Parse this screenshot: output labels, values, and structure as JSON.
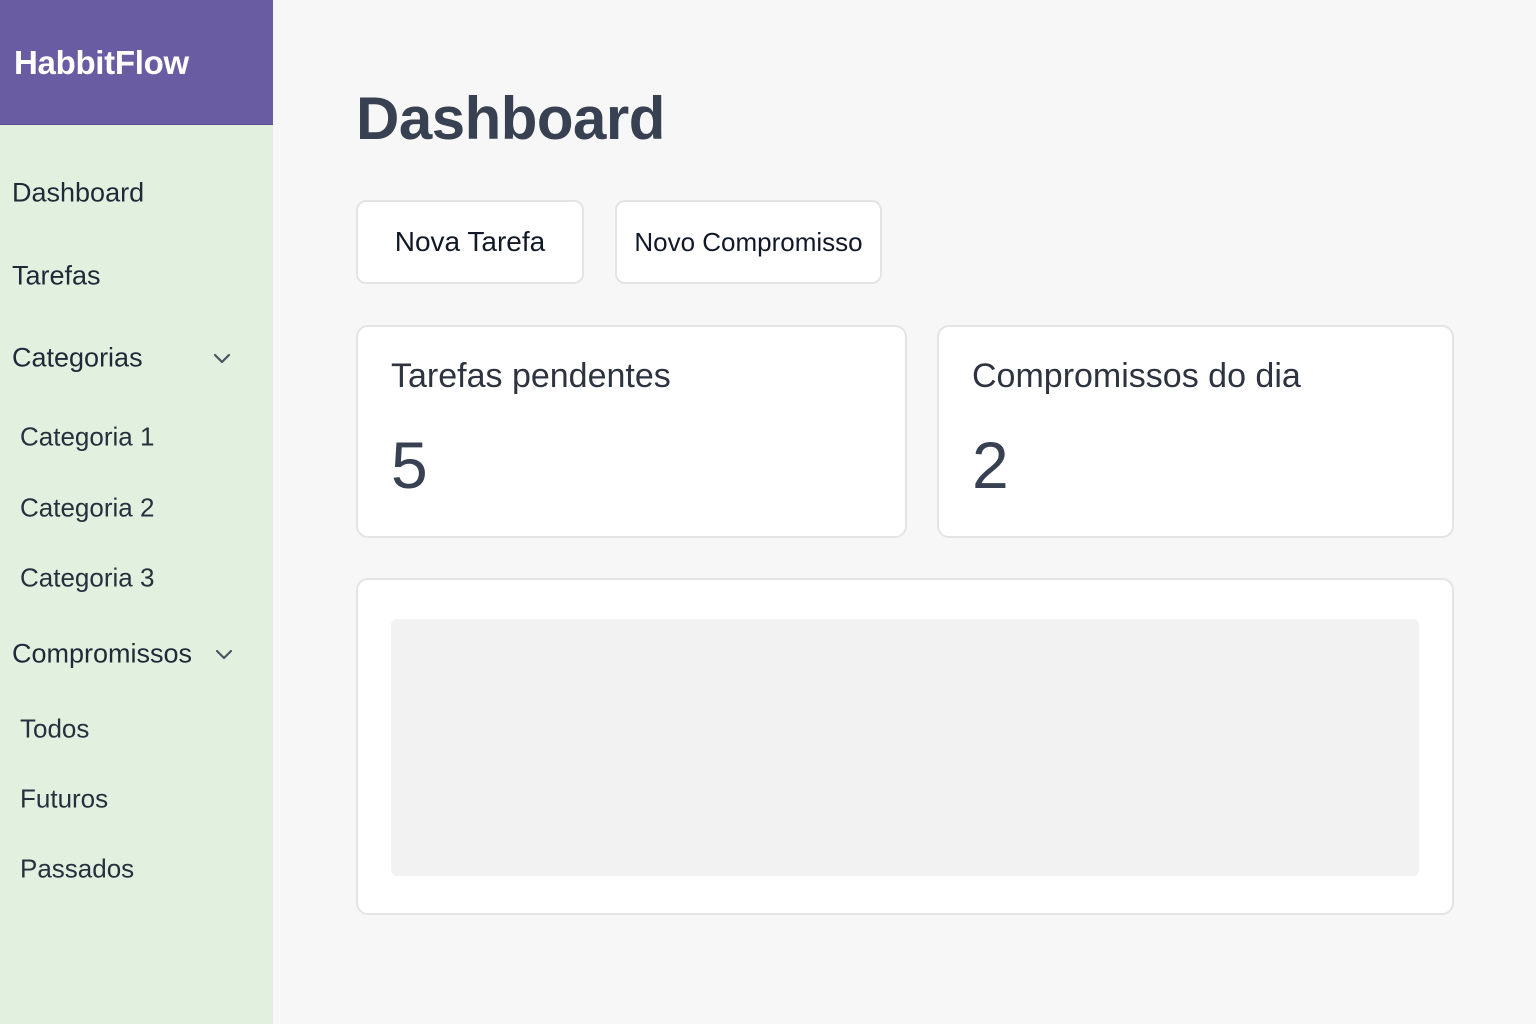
{
  "app": {
    "name": "HabbitFlow",
    "brand_color": "#6a5ca3",
    "sidebar_color": "#e2f0e0"
  },
  "sidebar": {
    "dashboard": "Dashboard",
    "tarefas": "Tarefas",
    "categorias": {
      "label": "Categorias",
      "expanded": true,
      "icon": "chevron-down-icon",
      "items": [
        "Categoria 1",
        "Categoria 2",
        "Categoria 3"
      ]
    },
    "compromissos": {
      "label": "Compromissos",
      "expanded": true,
      "icon": "chevron-down-icon",
      "items": [
        "Todos",
        "Futuros",
        "Passados"
      ]
    }
  },
  "main": {
    "title": "Dashboard",
    "actions": {
      "new_task": "Nova Tarefa",
      "new_appointment": "Novo Compromisso"
    },
    "cards": [
      {
        "title": "Tarefas pendentes",
        "value": "5"
      },
      {
        "title": "Compromissos do dia",
        "value": "2"
      }
    ]
  }
}
